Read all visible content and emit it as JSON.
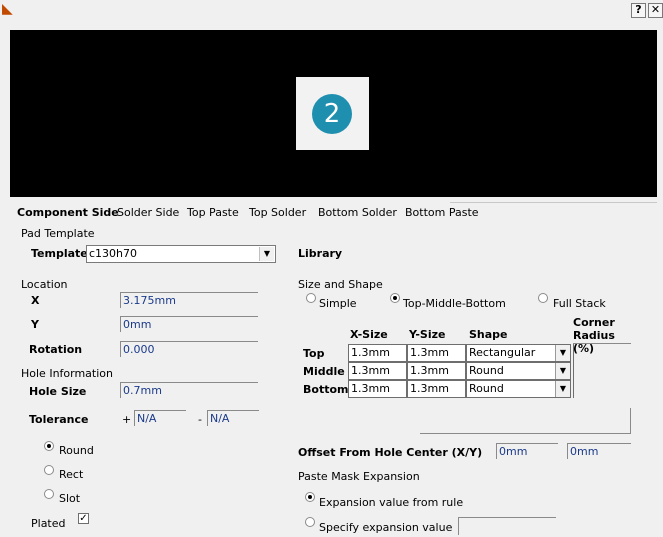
{
  "window": {
    "help_label": "?",
    "close_label": "✕"
  },
  "preview": {
    "pad_number": "2",
    "background_color": "#000000",
    "pad_color": "#1f8fb0"
  },
  "tabs": [
    {
      "label": "Component Side",
      "active": true
    },
    {
      "label": "Solder Side"
    },
    {
      "label": "Top Paste"
    },
    {
      "label": "Top Solder"
    },
    {
      "label": "Bottom Solder"
    },
    {
      "label": "Bottom Paste"
    }
  ],
  "pad_template": {
    "section_label": "Pad Template",
    "template_label": "Template",
    "template_value": "c130h70",
    "library_label": "Library"
  },
  "location": {
    "section_label": "Location",
    "x_label": "X",
    "x_value": "3.175mm",
    "y_label": "Y",
    "y_value": "0mm",
    "rotation_label": "Rotation",
    "rotation_value": "0.000"
  },
  "hole": {
    "section_label": "Hole Information",
    "size_label": "Hole Size",
    "size_value": "0.7mm",
    "tolerance_label": "Tolerance",
    "plus_sign": "+",
    "plus_value": "N/A",
    "minus_sign": "-",
    "minus_value": "N/A",
    "shapes": [
      "Round",
      "Rect",
      "Slot"
    ],
    "selected_shape": "Round",
    "plated_label": "Plated",
    "plated_checked": true
  },
  "size_shape": {
    "section_label": "Size and Shape",
    "modes": [
      "Simple",
      "Top-Middle-Bottom",
      "Full Stack"
    ],
    "selected_mode": "Top-Middle-Bottom",
    "headers": {
      "x_size": "X-Size",
      "y_size": "Y-Size",
      "shape": "Shape",
      "corner_radius": "Corner Radius (%)"
    },
    "rows": [
      {
        "layer": "Top",
        "x": "1.3mm",
        "y": "1.3mm",
        "shape": "Rectangular"
      },
      {
        "layer": "Middle",
        "x": "1.3mm",
        "y": "1.3mm",
        "shape": "Round"
      },
      {
        "layer": "Bottom",
        "x": "1.3mm",
        "y": "1.3mm",
        "shape": "Round"
      }
    ]
  },
  "offset": {
    "label": "Offset From Hole Center (X/Y)",
    "x_value": "0mm",
    "y_value": "0mm"
  },
  "paste_mask": {
    "section_label": "Paste Mask Expansion",
    "options": [
      "Expansion value from rule",
      "Specify expansion value"
    ],
    "selected": "Expansion value from rule",
    "value": ""
  }
}
